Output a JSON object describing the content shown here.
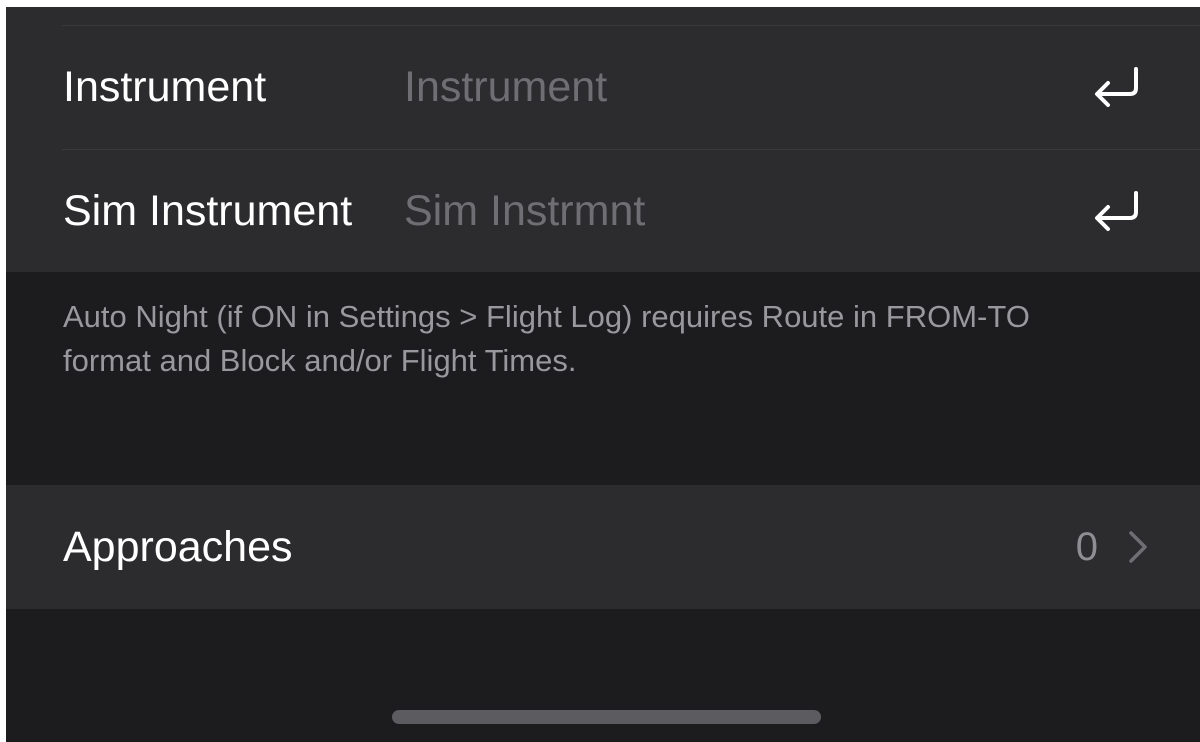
{
  "fields": {
    "instrument": {
      "label": "Instrument",
      "placeholder": "Instrument",
      "value": ""
    },
    "sim_instrument": {
      "label": "Sim Instrument",
      "placeholder": "Sim Instrmnt",
      "value": ""
    },
    "return_icon": "return-arrow-icon"
  },
  "footer_note": "Auto Night (if ON in Settings > Flight Log) requires Route in FROM-TO format and Block and/or Flight Times.",
  "approaches": {
    "label": "Approaches",
    "count": "0",
    "icon": "chevron-right-icon"
  },
  "colors": {
    "background": "#1c1c1e",
    "cell": "#2c2c2e",
    "separator": "#3a3a3c",
    "label": "#ffffff",
    "placeholder": "#6f6f73",
    "secondary_text": "#98989d"
  }
}
